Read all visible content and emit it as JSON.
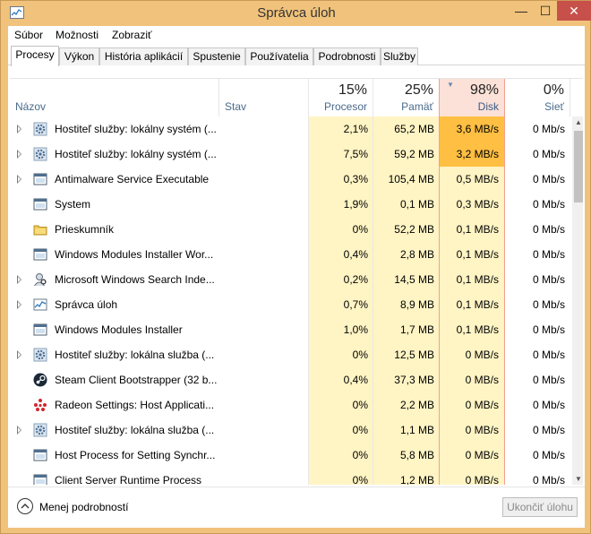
{
  "window": {
    "title": "Správca úloh",
    "minimize": "—",
    "maximize": "☐",
    "close": "✕"
  },
  "menu": {
    "items": [
      "Súbor",
      "Možnosti",
      "Zobraziť"
    ]
  },
  "tabs": [
    "Procesy",
    "Výkon",
    "História aplikácií",
    "Spustenie",
    "Používatelia",
    "Podrobnosti",
    "Služby"
  ],
  "active_tab": "Procesy",
  "columns": {
    "name": "Názov",
    "status": "Stav",
    "cpu": {
      "label": "Procesor",
      "pct": "15%"
    },
    "memory": {
      "label": "Pamäť",
      "pct": "25%"
    },
    "disk": {
      "label": "Disk",
      "pct": "98%"
    },
    "network": {
      "label": "Sieť",
      "pct": "0%"
    }
  },
  "colors": {
    "heat_light": "#fff4c4",
    "heat_medium": "#ffe8a8",
    "disk_high": "#ffbf42",
    "disk_header": "#fbe1d7",
    "window_border": "#f0c27b",
    "close_button": "#c7504b"
  },
  "processes": [
    {
      "name": "Hostiteľ služby: lokálny systém (...",
      "icon": "gear-service-icon",
      "expandable": true,
      "cpu": "2,1%",
      "memory": "65,2 MB",
      "disk": "3,6 MB/s",
      "network": "0 Mb/s",
      "disk_high": true
    },
    {
      "name": "Hostiteľ služby: lokálny systém (...",
      "icon": "gear-service-icon",
      "expandable": true,
      "cpu": "7,5%",
      "memory": "59,2 MB",
      "disk": "3,2 MB/s",
      "network": "0 Mb/s",
      "disk_high": true
    },
    {
      "name": "Antimalware Service Executable",
      "icon": "window-app-icon",
      "expandable": true,
      "cpu": "0,3%",
      "memory": "105,4 MB",
      "disk": "0,5 MB/s",
      "network": "0 Mb/s",
      "disk_high": false
    },
    {
      "name": "System",
      "icon": "window-app-icon",
      "expandable": false,
      "cpu": "1,9%",
      "memory": "0,1 MB",
      "disk": "0,3 MB/s",
      "network": "0 Mb/s",
      "disk_high": false
    },
    {
      "name": "Prieskumník",
      "icon": "folder-icon",
      "expandable": false,
      "cpu": "0%",
      "memory": "52,2 MB",
      "disk": "0,1 MB/s",
      "network": "0 Mb/s",
      "disk_high": false
    },
    {
      "name": "Windows Modules Installer Wor...",
      "icon": "window-app-icon",
      "expandable": false,
      "cpu": "0,4%",
      "memory": "2,8 MB",
      "disk": "0,1 MB/s",
      "network": "0 Mb/s",
      "disk_high": false
    },
    {
      "name": "Microsoft Windows Search Inde...",
      "icon": "search-person-icon",
      "expandable": true,
      "cpu": "0,2%",
      "memory": "14,5 MB",
      "disk": "0,1 MB/s",
      "network": "0 Mb/s",
      "disk_high": false
    },
    {
      "name": "Správca úloh",
      "icon": "task-manager-icon",
      "expandable": true,
      "cpu": "0,7%",
      "memory": "8,9 MB",
      "disk": "0,1 MB/s",
      "network": "0 Mb/s",
      "disk_high": false
    },
    {
      "name": "Windows Modules Installer",
      "icon": "window-app-icon",
      "expandable": false,
      "cpu": "1,0%",
      "memory": "1,7 MB",
      "disk": "0,1 MB/s",
      "network": "0 Mb/s",
      "disk_high": false
    },
    {
      "name": "Hostiteľ služby: lokálna služba (...",
      "icon": "gear-service-icon",
      "expandable": true,
      "cpu": "0%",
      "memory": "12,5 MB",
      "disk": "0 MB/s",
      "network": "0 Mb/s",
      "disk_high": false
    },
    {
      "name": "Steam Client Bootstrapper (32 b...",
      "icon": "steam-icon",
      "expandable": false,
      "cpu": "0,4%",
      "memory": "37,3 MB",
      "disk": "0 MB/s",
      "network": "0 Mb/s",
      "disk_high": false
    },
    {
      "name": "Radeon Settings: Host Applicati...",
      "icon": "radeon-icon",
      "expandable": false,
      "cpu": "0%",
      "memory": "2,2 MB",
      "disk": "0 MB/s",
      "network": "0 Mb/s",
      "disk_high": false
    },
    {
      "name": "Hostiteľ služby: lokálna služba (...",
      "icon": "gear-service-icon",
      "expandable": true,
      "cpu": "0%",
      "memory": "1,1 MB",
      "disk": "0 MB/s",
      "network": "0 Mb/s",
      "disk_high": false
    },
    {
      "name": "Host Process for Setting Synchr...",
      "icon": "window-app-icon",
      "expandable": false,
      "cpu": "0%",
      "memory": "5,8 MB",
      "disk": "0 MB/s",
      "network": "0 Mb/s",
      "disk_high": false
    },
    {
      "name": "Client Server Runtime Process",
      "icon": "window-app-icon",
      "expandable": false,
      "cpu": "0%",
      "memory": "1,2 MB",
      "disk": "0 MB/s",
      "network": "0 Mb/s",
      "disk_high": false
    }
  ],
  "footer": {
    "fewer_details": "Menej podrobností",
    "end_task": "Ukončiť úlohu"
  }
}
